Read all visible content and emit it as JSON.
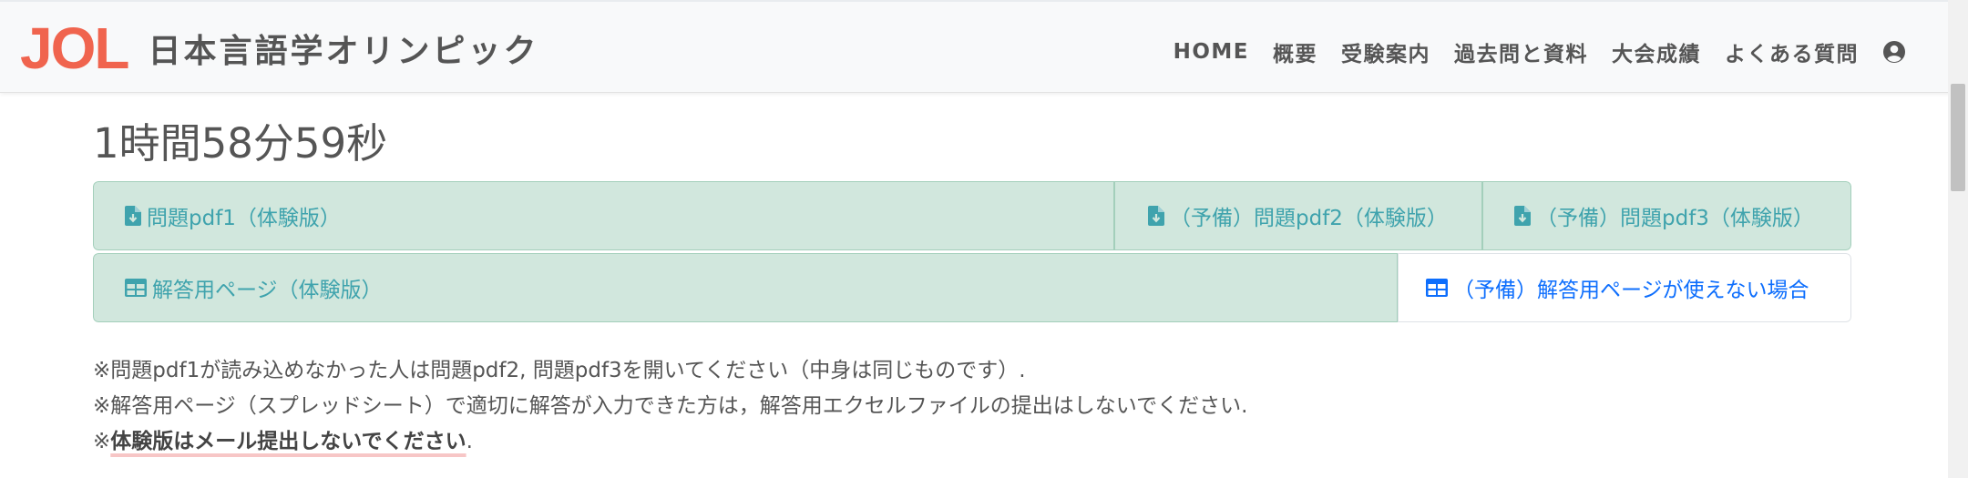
{
  "header": {
    "logo_text": "JOL",
    "site_name": "日本言語学オリンピック",
    "nav": [
      "HOME",
      "概要",
      "受験案内",
      "過去問と資料",
      "大会成績",
      "よくある質問"
    ],
    "user_icon": "user-circle-icon"
  },
  "timer": "1時間58分59秒",
  "buttons_row1": [
    {
      "label": "問題pdf1（体験版）",
      "icon": "file-download-icon"
    },
    {
      "label": "（予備）問題pdf2（体験版）",
      "icon": "file-download-icon"
    },
    {
      "label": "（予備）問題pdf3（体験版）",
      "icon": "file-download-icon"
    }
  ],
  "buttons_row2": [
    {
      "label": "解答用ページ（体験版）",
      "icon": "table-icon"
    },
    {
      "label": "（予備）解答用ページが使えない場合",
      "icon": "table-icon"
    }
  ],
  "notes": [
    "※問題pdf1が読み込めなかった人は問題pdf2, 問題pdf3を開いてください（中身は同じものです）.",
    "※解答用ページ（スプレッドシート）で適切に解答が入力できた方は，解答用エクセルファイルの提出はしないでください."
  ],
  "note3": {
    "prefix": "※",
    "bold": "体験版はメール提出しないでください",
    "suffix": "."
  },
  "colors": {
    "logo": "#f0644e",
    "success_bg": "#d1e7dd",
    "success_border": "#a3cfbb",
    "success_text": "#3fa3ad",
    "primary_text": "#0d6efd"
  }
}
